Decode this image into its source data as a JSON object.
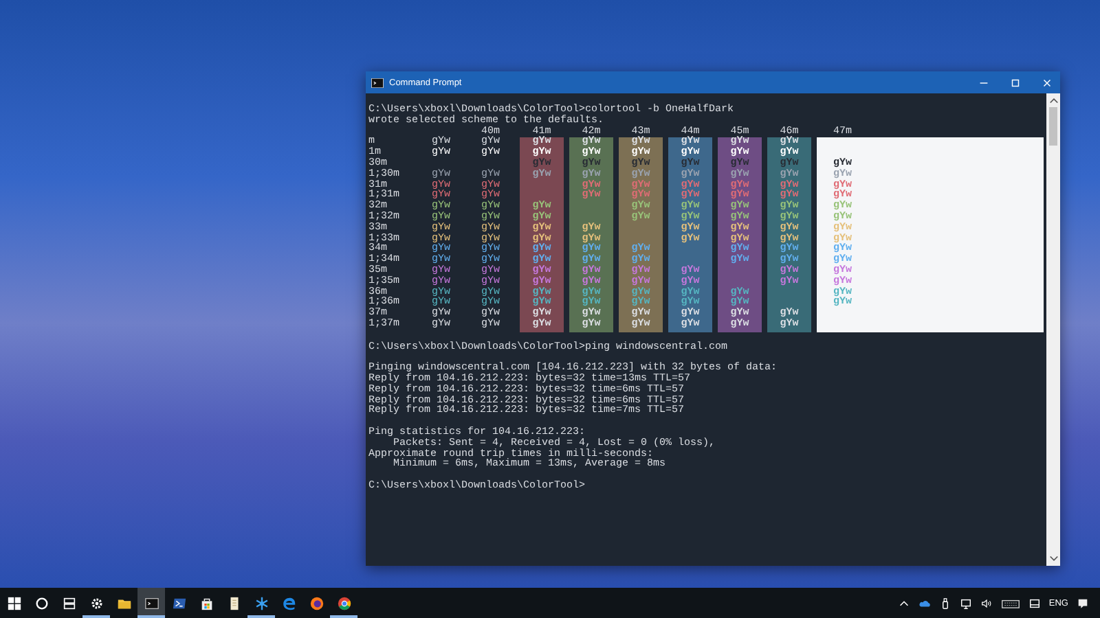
{
  "window": {
    "title": "Command Prompt"
  },
  "console": {
    "blocks_before": [
      [
        "C:\\Users\\xboxl\\Downloads\\ColorTool>colortool -b OneHalfDark",
        "wrote selected scheme to the defaults."
      ]
    ],
    "color_table": {
      "rows": [
        {
          "label": "m",
          "color": "#dcdfe4"
        },
        {
          "label": "1m",
          "color": "#ffffff"
        },
        {
          "label": "30m",
          "color": "#282c34"
        },
        {
          "label": "1;30m",
          "color": "#9aa3b0"
        },
        {
          "label": "31m",
          "color": "#e06c75"
        },
        {
          "label": "1;31m",
          "color": "#e06c75"
        },
        {
          "label": "32m",
          "color": "#98c379"
        },
        {
          "label": "1;32m",
          "color": "#98c379"
        },
        {
          "label": "33m",
          "color": "#e5c07b"
        },
        {
          "label": "1;33m",
          "color": "#e5c07b"
        },
        {
          "label": "34m",
          "color": "#61afef"
        },
        {
          "label": "1;34m",
          "color": "#61afef"
        },
        {
          "label": "35m",
          "color": "#c678dd"
        },
        {
          "label": "1;35m",
          "color": "#c678dd"
        },
        {
          "label": "36m",
          "color": "#56b6c2"
        },
        {
          "label": "1;36m",
          "color": "#56b6c2"
        },
        {
          "label": "37m",
          "color": "#dcdfe4"
        },
        {
          "label": "1;37m",
          "color": "#dcdfe4"
        }
      ],
      "columns": [
        {
          "cells": [
            "gYw",
            "gYw",
            null,
            "gYw",
            "gYw",
            "gYw",
            "gYw",
            "gYw",
            "gYw",
            "gYw",
            "gYw",
            "gYw",
            "gYw",
            "gYw",
            "gYw",
            "gYw",
            "gYw",
            "gYw"
          ]
        },
        {
          "header": "40m",
          "cells": [
            "gYw",
            "gYw",
            null,
            "gYw",
            "gYw",
            "gYw",
            "gYw",
            "gYw",
            "gYw",
            "gYw",
            "gYw",
            "gYw",
            "gYw",
            "gYw",
            "gYw",
            "gYw",
            "gYw",
            "gYw"
          ]
        },
        {
          "header": "41m",
          "color": "#7b4852",
          "cells": [
            "gYw",
            "gYw",
            "gYw",
            "gYw",
            null,
            null,
            "gYw",
            "gYw",
            "gYw",
            "gYw",
            "gYw",
            "gYw",
            "gYw",
            "gYw",
            "gYw",
            "gYw",
            "gYw",
            "gYw"
          ]
        },
        {
          "header": "42m",
          "color": "#597153",
          "cells": [
            "gYw",
            "gYw",
            "gYw",
            "gYw",
            "gYw",
            "gYw",
            null,
            null,
            "gYw",
            "gYw",
            "gYw",
            "gYw",
            "gYw",
            "gYw",
            "gYw",
            "gYw",
            "gYw",
            "gYw"
          ]
        },
        {
          "header": "43m",
          "color": "#7d7054",
          "cells": [
            "gYw",
            "gYw",
            "gYw",
            "gYw",
            "gYw",
            "gYw",
            "gYw",
            "gYw",
            null,
            null,
            "gYw",
            "gYw",
            "gYw",
            "gYw",
            "gYw",
            "gYw",
            "gYw",
            "gYw"
          ]
        },
        {
          "header": "44m",
          "color": "#3e688c",
          "cells": [
            "gYw",
            "gYw",
            "gYw",
            "gYw",
            "gYw",
            "gYw",
            "gYw",
            "gYw",
            "gYw",
            "gYw",
            null,
            null,
            "gYw",
            "gYw",
            "gYw",
            "gYw",
            "gYw",
            "gYw"
          ]
        },
        {
          "header": "45m",
          "color": "#6e4d84",
          "cells": [
            "gYw",
            "gYw",
            "gYw",
            "gYw",
            "gYw",
            "gYw",
            "gYw",
            "gYw",
            "gYw",
            "gYw",
            "gYw",
            "gYw",
            null,
            null,
            "gYw",
            "gYw",
            "gYw",
            "gYw"
          ]
        },
        {
          "header": "46m",
          "color": "#396b77",
          "cells": [
            "gYw",
            "gYw",
            "gYw",
            "gYw",
            "gYw",
            "gYw",
            "gYw",
            "gYw",
            "gYw",
            "gYw",
            "gYw",
            "gYw",
            "gYw",
            "gYw",
            null,
            null,
            "gYw",
            "gYw"
          ]
        },
        {
          "header": "47m",
          "color": "#f5f6f8",
          "cells": [
            null,
            null,
            "gYw",
            "gYw",
            "gYw",
            "gYw",
            "gYw",
            "gYw",
            "gYw",
            "gYw",
            "gYw",
            "gYw",
            "gYw",
            "gYw",
            "gYw",
            "gYw",
            null,
            null
          ]
        }
      ]
    },
    "blocks_after": [
      [
        "C:\\Users\\xboxl\\Downloads\\ColorTool>ping windowscentral.com"
      ],
      [
        "Pinging windowscentral.com [104.16.212.223] with 32 bytes of data:",
        "Reply from 104.16.212.223: bytes=32 time=13ms TTL=57",
        "Reply from 104.16.212.223: bytes=32 time=6ms TTL=57",
        "Reply from 104.16.212.223: bytes=32 time=6ms TTL=57",
        "Reply from 104.16.212.223: bytes=32 time=7ms TTL=57"
      ],
      [
        "Ping statistics for 104.16.212.223:",
        "    Packets: Sent = 4, Received = 4, Lost = 0 (0% loss),",
        "Approximate round trip times in milli-seconds:",
        "    Minimum = 6ms, Maximum = 13ms, Average = 8ms"
      ],
      [
        "C:\\Users\\xboxl\\Downloads\\ColorTool>"
      ]
    ]
  },
  "taskbar": {
    "apps": [
      {
        "kind": "start",
        "running": false,
        "selected": false
      },
      {
        "kind": "search",
        "running": false,
        "selected": false
      },
      {
        "kind": "taskview",
        "running": false,
        "selected": false
      },
      {
        "kind": "settings",
        "running": true,
        "selected": false
      },
      {
        "kind": "folder",
        "running": false,
        "selected": false
      },
      {
        "kind": "terminal",
        "running": true,
        "selected": true
      },
      {
        "kind": "shell",
        "running": false,
        "selected": false
      },
      {
        "kind": "store",
        "running": false,
        "selected": false
      },
      {
        "kind": "document",
        "running": false,
        "selected": false
      },
      {
        "kind": "snowflake",
        "running": true,
        "selected": false
      },
      {
        "kind": "edge",
        "running": false,
        "selected": false
      },
      {
        "kind": "fox",
        "running": false,
        "selected": false
      },
      {
        "kind": "chrome",
        "running": true,
        "selected": false
      }
    ],
    "language": "ENG"
  }
}
